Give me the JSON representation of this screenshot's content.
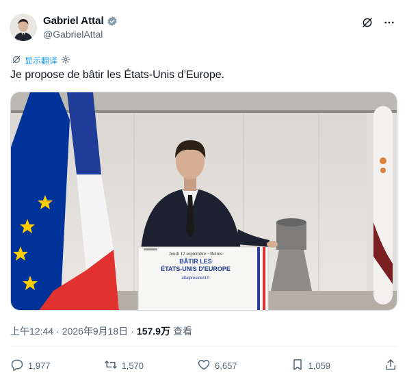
{
  "author": {
    "display_name": "Gabriel Attal",
    "handle": "@GabrielAttal",
    "verified_icon": "verified-badge-icon"
  },
  "top_actions": {
    "grok_icon": "grok-icon",
    "more_icon": "more-icon"
  },
  "translate": {
    "label": "显示翻译"
  },
  "tweet": {
    "text": "Je propose de bâtir les États-Unis d’Europe."
  },
  "media": {
    "podium_line1": "Jeudi 12 septembre · Reims",
    "podium_line2": "BÂTIR LES",
    "podium_line3": "ÉTATS-UNIS D'EUROPE",
    "podium_line4": "attalpresident.fr"
  },
  "meta": {
    "time": "上午12:44",
    "separator1": "·",
    "date": "2026年9月18日",
    "separator2": "·",
    "views_count": "157.9万",
    "views_label": "查看"
  },
  "actions": {
    "replies": "1,977",
    "reposts": "1,570",
    "likes": "6,657",
    "bookmarks": "1,059"
  },
  "colors": {
    "text_primary": "#0f1419",
    "text_secondary": "#536471",
    "accent": "#1d9bf0",
    "divider": "#eff3f4"
  }
}
